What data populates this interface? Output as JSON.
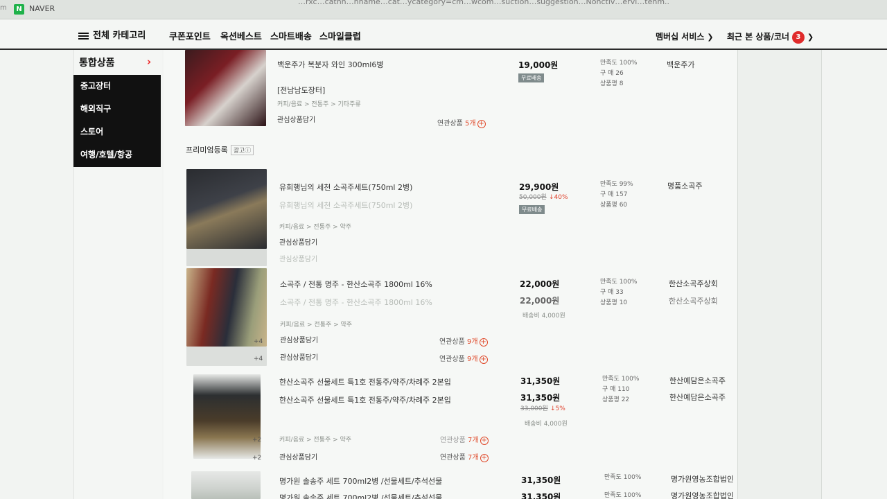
{
  "browser": {
    "edge_label": "m",
    "tab_title": "NAVER",
    "url_fragment": "…rxc…catnn…nname…cat…ycategory=cm…wcom…suction…suggestion…Nonctiv…ervi…tenm.."
  },
  "nav": {
    "all_categories": "전체 카테고리",
    "links": [
      "쿠폰포인트",
      "옥션베스트",
      "스마트배송",
      "스마일클럽"
    ],
    "membership": "멤버십 서비스",
    "recent": "최근 본 상품/코너",
    "recent_count": "3"
  },
  "sidebar": {
    "title": "통합상품",
    "items": [
      "중고장터",
      "해외직구",
      "스토어",
      "여행/호텔/항공"
    ]
  },
  "premium": {
    "label": "프리미엄등록",
    "ad": "광고ⓘ"
  },
  "products": [
    {
      "title": "백운주가 복분자 와인 300ml6병",
      "subtitle": "[전남남도장터]",
      "path": "커피/음료 > 전통주 > 기타주류",
      "wish": "관심상품담기",
      "related": "연관상품",
      "related_count": "5개",
      "price": "19,000원",
      "ship": "무료배송",
      "stats": [
        "만족도 100%",
        "구 매 26",
        "상품평 8"
      ],
      "seller": "백운주가"
    },
    {
      "title": "유희행님의 세천 소곡주세트(750ml 2병)",
      "ghost": "유희행님의 세천 소곡주세트(750ml 2병)",
      "path": "커피/음료 > 전통주 > 약주",
      "wish": "관심상품담기",
      "price": "29,900원",
      "price_ghost": "29,900원",
      "strike": "50,000원",
      "disc": "↓40%",
      "ship": "무료배송",
      "stats": [
        "만족도 99%",
        "구 매 157",
        "상품평 60"
      ],
      "seller": "명품소곡주"
    },
    {
      "title": "소곡주 / 전통 명주 - 한산소곡주 1800ml 16%",
      "ghost": "소곡주 / 전통 명주 - 한산소곡주 1800ml 16%",
      "path": "커피/음료 > 전통주 > 약주",
      "wish": "관심상품담기",
      "related": "연관상품",
      "related_count": "9개",
      "price": "22,000원",
      "price_ghost": "22,000원",
      "shipfee": "배송비 4,000원",
      "stats": [
        "만족도 100%",
        "구 매 33",
        "상품평 10"
      ],
      "seller": "한산소곡주상회",
      "img_count": "+4"
    },
    {
      "title": "한산소곡주 선물세트 특1호 전통주/약주/차례주 2본입",
      "ghost": "한산소곡주 선물세트 특1호 전통주/약주/차례주 2본입",
      "path": "커피/음료 > 전통주 > 약주",
      "wish": "관심상품담기",
      "related": "연관상품",
      "related_count": "7개",
      "price": "31,350원",
      "price_ghost": "31,350원",
      "strike": "33,000원",
      "disc": "↓5%",
      "shipfee": "배송비 4,000원",
      "stats": [
        "만족도 100%",
        "구 매 110",
        "상품평 22"
      ],
      "seller": "한산예담은소곡주",
      "img_count": "+2"
    },
    {
      "title": "명가원 솔송주 세트 700ml2병 /선물세트/추석선물",
      "ghost": "명가원 솔송주 세트 700ml2병 /선물세트/추석선물",
      "price": "31,350원",
      "stats": [
        "만족도 100%"
      ],
      "seller": "명가원영농조합법인"
    }
  ]
}
